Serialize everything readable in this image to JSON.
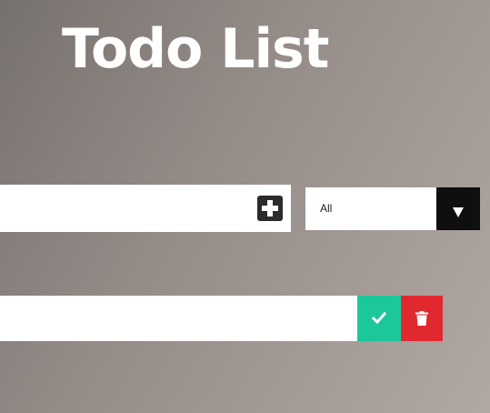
{
  "header": {
    "title": "Todo List"
  },
  "form": {
    "input_value": "",
    "add_icon": "plus-square-icon",
    "filter": {
      "selected": "All",
      "arrow_icon": "caret-down-icon"
    }
  },
  "todos": [
    {
      "text": "",
      "complete_icon": "check-icon",
      "delete_icon": "trash-icon"
    }
  ],
  "colors": {
    "complete": "#1dc79c",
    "delete": "#e2282f",
    "add_button": "#2b2b2b",
    "select_arrow_bg": "#0f0f0f"
  }
}
